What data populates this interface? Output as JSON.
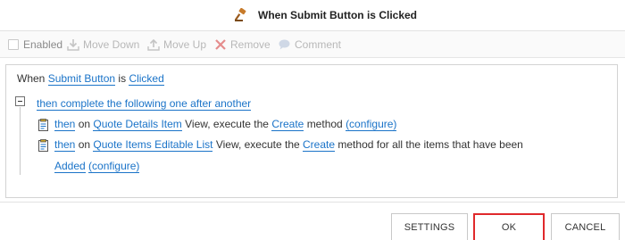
{
  "dialog": {
    "title": "When Submit Button is Clicked"
  },
  "toolbar": {
    "enabled": "Enabled",
    "move_down": "Move Down",
    "move_up": "Move Up",
    "remove": "Remove",
    "comment": "Comment"
  },
  "rule": {
    "when": {
      "prefix": "When",
      "subject": "Submit Button",
      "is": "is",
      "event": "Clicked"
    },
    "group": {
      "text": "then complete the following one after another"
    },
    "step1": {
      "then": "then",
      "on": "on",
      "view": "Quote Details Item",
      "middle": "View, execute the",
      "method": "Create",
      "method_word": "method",
      "configure": "(configure)"
    },
    "step2": {
      "then": "then",
      "on": "on",
      "view": "Quote Items Editable List",
      "middle": "View, execute the",
      "method": "Create",
      "tail": "method for all the items that have been",
      "added": "Added",
      "configure": "(configure)"
    }
  },
  "footer": {
    "settings": "SETTINGS",
    "ok": "OK",
    "cancel": "CANCEL"
  },
  "colors": {
    "link": "#1a73c8",
    "ok_highlight": "#e0292b",
    "title_icon": "#c77b2b"
  }
}
